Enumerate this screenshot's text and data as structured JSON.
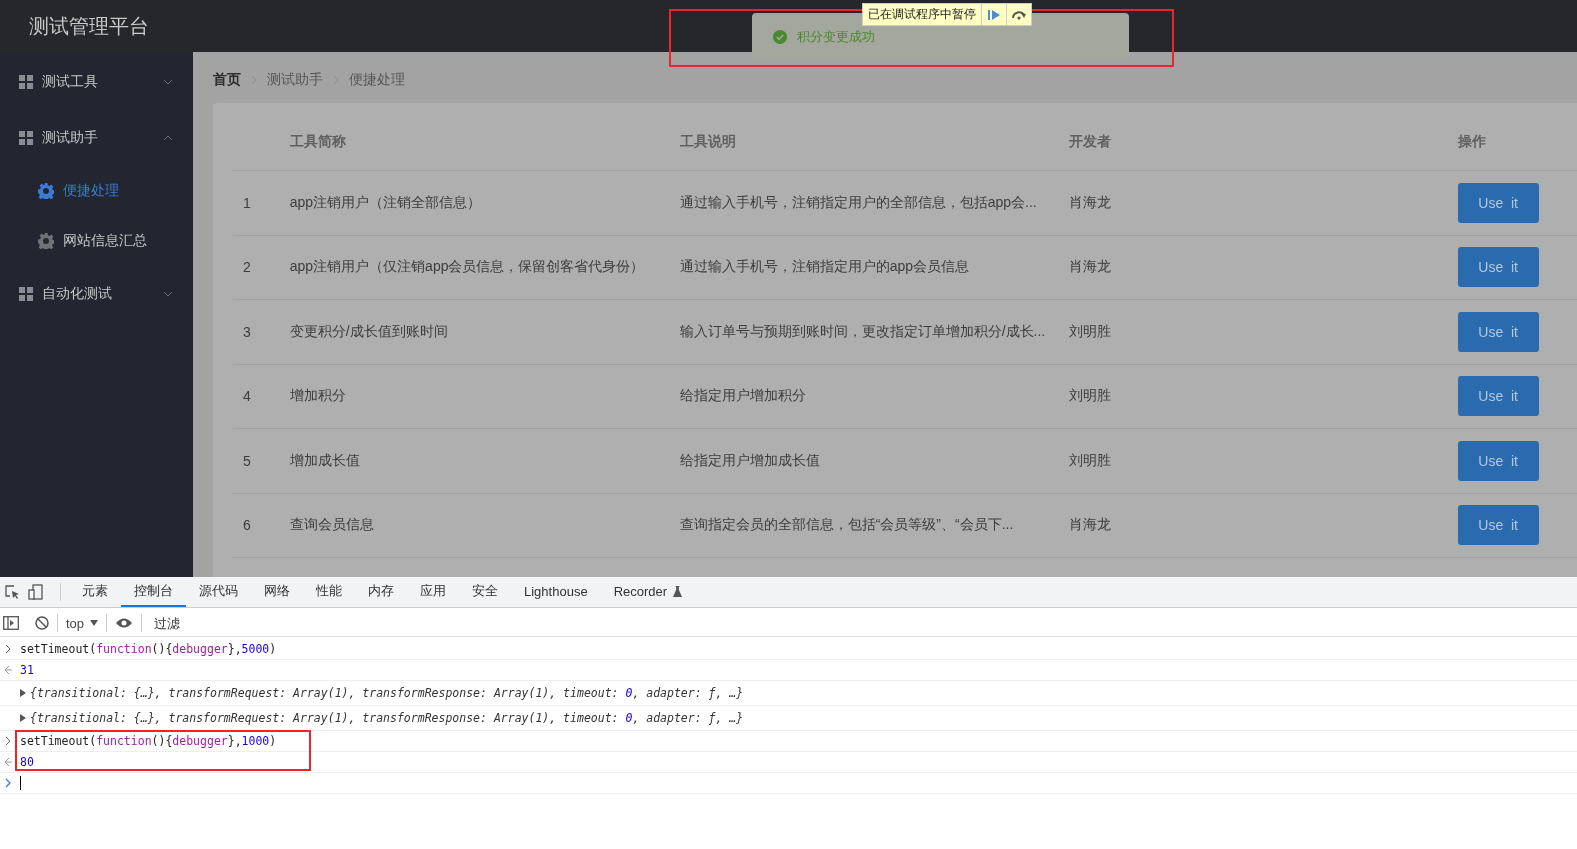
{
  "header": {
    "title": "测试管理平台"
  },
  "debugger_banner": {
    "text": "已在调试程序中暂停"
  },
  "toast": {
    "message": "积分变更成功"
  },
  "sidebar": {
    "items": [
      {
        "label": "测试工具",
        "expanded": false
      },
      {
        "label": "测试助手",
        "expanded": true,
        "children": [
          {
            "label": "便捷处理",
            "selected": true
          },
          {
            "label": "网站信息汇总",
            "selected": false
          }
        ]
      },
      {
        "label": "自动化测试",
        "expanded": false
      }
    ]
  },
  "breadcrumb": [
    "首页",
    "测试助手",
    "便捷处理"
  ],
  "table": {
    "columns": [
      "工具简称",
      "工具说明",
      "开发者",
      "操作"
    ],
    "rows": [
      {
        "index": "1",
        "name": "app注销用户（注销全部信息）",
        "description": "通过输入手机号，注销指定用户的全部信息，包括app会...",
        "developer": "肖海龙",
        "action": "Use  it"
      },
      {
        "index": "2",
        "name": "app注销用户（仅注销app会员信息，保留创客省代身份）",
        "description": "通过输入手机号，注销指定用户的app会员信息",
        "developer": "肖海龙",
        "action": "Use  it"
      },
      {
        "index": "3",
        "name": "变更积分/成长值到账时间",
        "description": "输入订单号与预期到账时间，更改指定订单增加积分/成长...",
        "developer": "刘明胜",
        "action": "Use  it"
      },
      {
        "index": "4",
        "name": "增加积分",
        "description": "给指定用户增加积分",
        "developer": "刘明胜",
        "action": "Use  it"
      },
      {
        "index": "5",
        "name": "增加成长值",
        "description": "给指定用户增加成长值",
        "developer": "刘明胜",
        "action": "Use  it"
      },
      {
        "index": "6",
        "name": "查询会员信息",
        "description": "查询指定会员的全部信息，包括“会员等级”、“会员下...",
        "developer": "肖海龙",
        "action": "Use  it"
      }
    ]
  },
  "devtools": {
    "tabs": [
      {
        "label": "元素",
        "selected": false
      },
      {
        "label": "控制台",
        "selected": true
      },
      {
        "label": "源代码",
        "selected": false
      },
      {
        "label": "网络",
        "selected": false
      },
      {
        "label": "性能",
        "selected": false
      },
      {
        "label": "内存",
        "selected": false
      },
      {
        "label": "应用",
        "selected": false
      },
      {
        "label": "安全",
        "selected": false
      },
      {
        "label": "Lighthouse",
        "selected": false
      },
      {
        "label": "Recorder",
        "selected": false
      }
    ],
    "context": "top",
    "filter_placeholder": "过滤",
    "console": [
      {
        "kind": "input",
        "tokens": [
          {
            "kind": "plain",
            "text": "setTimeout("
          },
          {
            "kind": "keyword",
            "text": "function"
          },
          {
            "kind": "plain",
            "text": "(){"
          },
          {
            "kind": "keyword",
            "text": "debugger"
          },
          {
            "kind": "plain",
            "text": "},"
          },
          {
            "kind": "number",
            "text": "5000"
          },
          {
            "kind": "plain",
            "text": ")"
          }
        ]
      },
      {
        "kind": "output",
        "tokens": [
          {
            "kind": "number",
            "text": "31"
          }
        ]
      },
      {
        "kind": "object",
        "tokens": [
          {
            "kind": "plain",
            "text": "{transitional: {…}, transformRequest: Array(1), transformResponse: Array(1), timeout: "
          },
          {
            "kind": "number",
            "text": "0"
          },
          {
            "kind": "plain",
            "text": ", adapter: ƒ, …}"
          }
        ]
      },
      {
        "kind": "object",
        "tokens": [
          {
            "kind": "plain",
            "text": "{transitional: {…}, transformRequest: Array(1), transformResponse: Array(1), timeout: "
          },
          {
            "kind": "number",
            "text": "0"
          },
          {
            "kind": "plain",
            "text": ", adapter: ƒ, …}"
          }
        ]
      },
      {
        "kind": "input",
        "tokens": [
          {
            "kind": "plain",
            "text": "setTimeout("
          },
          {
            "kind": "keyword",
            "text": "function"
          },
          {
            "kind": "plain",
            "text": "(){"
          },
          {
            "kind": "keyword",
            "text": "debugger"
          },
          {
            "kind": "plain",
            "text": "},"
          },
          {
            "kind": "number",
            "text": "1000"
          },
          {
            "kind": "plain",
            "text": ")"
          }
        ]
      },
      {
        "kind": "output",
        "tokens": [
          {
            "kind": "number",
            "text": "80"
          }
        ]
      },
      {
        "kind": "prompt"
      }
    ]
  }
}
